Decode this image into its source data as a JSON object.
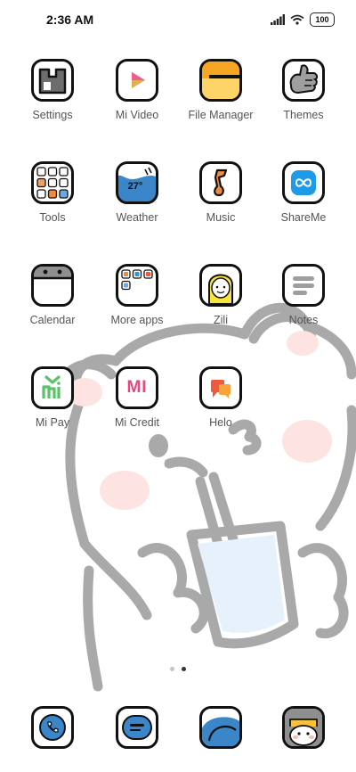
{
  "status_bar": {
    "time": "2:36 AM",
    "battery": "100"
  },
  "apps": [
    {
      "label": "Settings",
      "icon": "settings-icon"
    },
    {
      "label": "Mi Video",
      "icon": "mi-video-icon"
    },
    {
      "label": "File Manager",
      "icon": "file-manager-icon"
    },
    {
      "label": "Themes",
      "icon": "themes-icon"
    },
    {
      "label": "Tools",
      "icon": "tools-folder-icon"
    },
    {
      "label": "Weather",
      "icon": "weather-icon",
      "badge": "27°"
    },
    {
      "label": "Music",
      "icon": "music-icon"
    },
    {
      "label": "ShareMe",
      "icon": "shareme-icon"
    },
    {
      "label": "Calendar",
      "icon": "calendar-icon"
    },
    {
      "label": "More apps",
      "icon": "more-apps-folder-icon"
    },
    {
      "label": "Zili",
      "icon": "zili-icon"
    },
    {
      "label": "Notes",
      "icon": "notes-icon"
    },
    {
      "label": "Mi Pay",
      "icon": "mi-pay-icon"
    },
    {
      "label": "Mi Credit",
      "icon": "mi-credit-icon",
      "logo_text": "MI"
    },
    {
      "label": "Helo",
      "icon": "helo-icon"
    }
  ],
  "page_indicator": {
    "count": 2,
    "active_index": 1
  },
  "dock": [
    {
      "icon": "phone-icon"
    },
    {
      "icon": "messages-icon"
    },
    {
      "icon": "browser-icon"
    },
    {
      "icon": "camera-icon"
    }
  ],
  "colors": {
    "outline": "#111111",
    "label": "#555555",
    "wallpaper_line": "#a9a9a9",
    "wallpaper_blush": "#fde3e1",
    "wallpaper_cup": "#e6f1fb",
    "video_accent": "#3b82f6",
    "file_manager": "#f5a623",
    "weather": "#3a86c8",
    "music": "#f08a3c",
    "shareme": "#1e9be8",
    "mi_pay": "#5cc26a",
    "mi_credit": "#e8467c",
    "helo": "#ef5a3c"
  }
}
